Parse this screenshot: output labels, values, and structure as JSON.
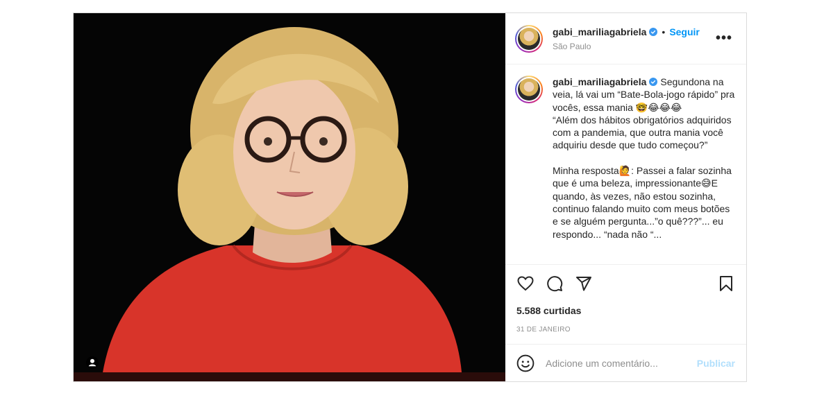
{
  "post": {
    "username": "gabi_mariliagabriela",
    "follow_label": "Seguir",
    "dot": "•",
    "location": "São Paulo",
    "more_label": "•••",
    "caption": "Segundona na veia, lá vai um “Bate-Bola-jogo rápido” pra vocês, essa mania 🤓😂😂😂\n“Além dos hábitos obrigatórios adquiridos com a pandemia, que outra mania você adquiriu desde que tudo começou?”\n\nMinha resposta🙋: Passei a falar sozinha que é uma beleza, impressionante😅E quando, às vezes, não estou sozinha, continuo falando muito com meus botões e se alguém pergunta...”o quê???”... eu respondo... “nada não “...",
    "likes": "5.588 curtidas",
    "date": "31 DE JANEIRO",
    "comment_placeholder": "Adicione um comentário...",
    "publish_label": "Publicar"
  },
  "icons": {
    "verified": "verified-badge-icon",
    "like": "heart-icon",
    "comment": "comment-bubble-icon",
    "share": "paper-plane-icon",
    "save": "bookmark-icon",
    "emoji": "smiley-icon",
    "user_tag": "user-tag-icon"
  },
  "colors": {
    "accent": "#0095f6",
    "publish_disabled": "#b2dffc",
    "muted": "#8e8e8e",
    "border": "#dbdbdb"
  }
}
